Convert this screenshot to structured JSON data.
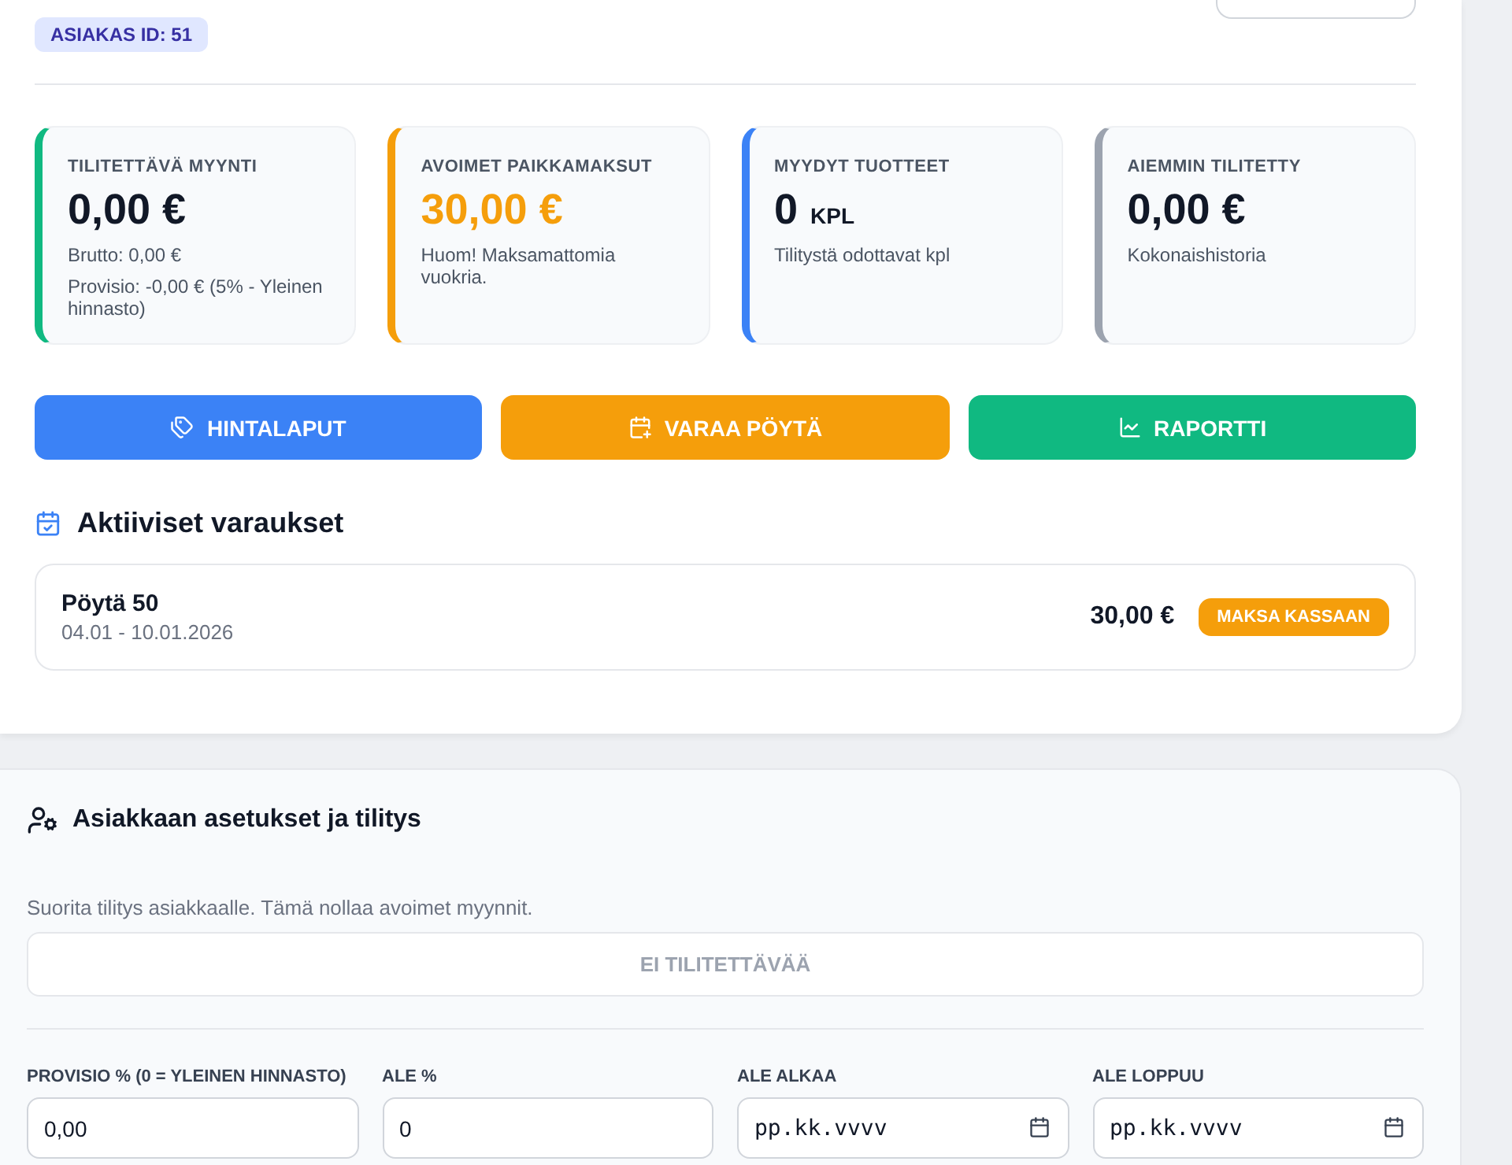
{
  "customer_badge": "ASIAKAS ID: 51",
  "stats": [
    {
      "label": "TILITETTÄVÄ MYYNTI",
      "value": "0,00 €",
      "notes": [
        "Brutto: 0,00 €",
        "Provisio: -0,00 € (5% - Yleinen hinnasto)"
      ],
      "color": "#10b981",
      "emphasis": false
    },
    {
      "label": "AVOIMET PAIKKAMAKSUT",
      "value": "30,00 €",
      "notes": [
        "Huom! Maksamattomia vuokria."
      ],
      "color": "#f59e0b",
      "emphasis": true
    },
    {
      "label": "MYYDYT TUOTTEET",
      "value": "0",
      "unit": "KPL",
      "notes": [
        "Tilitystä odottavat kpl"
      ],
      "color": "#3b82f6",
      "emphasis": false
    },
    {
      "label": "AIEMMIN TILITETTY",
      "value": "0,00 €",
      "notes": [
        "Kokonaishistoria"
      ],
      "color": "#9ca3af",
      "emphasis": false
    }
  ],
  "actions": [
    {
      "label": "HINTALAPUT",
      "color": "#3b82f6"
    },
    {
      "label": "VARAA PÖYTÄ",
      "color": "#f59e0b"
    },
    {
      "label": "RAPORTTI",
      "color": "#10b981"
    }
  ],
  "reservations": {
    "title": "Aktiiviset varaukset",
    "items": [
      {
        "name": "Pöytä 50",
        "dates": "04.01 - 10.01.2026",
        "amount": "30,00 €",
        "button": "MAKSA KASSAAN"
      }
    ]
  },
  "settings": {
    "title": "Asiakkaan asetukset ja tilitys",
    "note": "Suorita tilitys asiakkaalle. Tämä nollaa avoimet myynnit.",
    "settle_button": {
      "label": "EI TILITETTÄVÄÄ",
      "disabled": true
    },
    "fields": [
      {
        "label": "PROVISIO % (0 = YLEINEN HINNASTO)",
        "kind": "text",
        "value": "0,00"
      },
      {
        "label": "ALE %",
        "kind": "text",
        "value": "0"
      },
      {
        "label": "ALE ALKAA",
        "kind": "date",
        "placeholder": "pp.kk.vvvv"
      },
      {
        "label": "ALE LOPPUU",
        "kind": "date",
        "placeholder": "pp.kk.vvvv"
      }
    ]
  }
}
